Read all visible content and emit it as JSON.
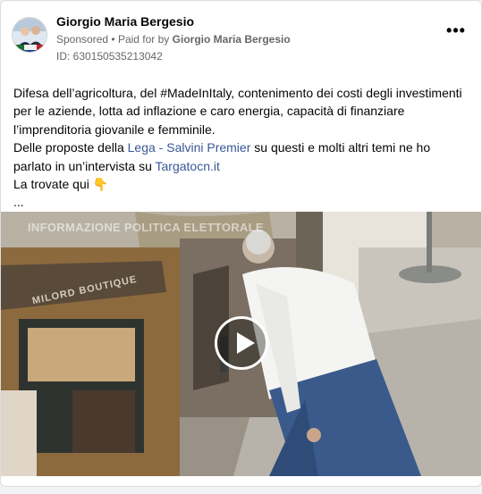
{
  "post": {
    "author": "Giorgio Maria Bergesio",
    "sponsored_label": "Sponsored",
    "paid_for_prefix": "Paid for by",
    "paid_for_name": "Giorgio Maria Bergesio",
    "separator": "•",
    "ad_id": "ID: 630150535213042",
    "more_icon": "more-options-icon",
    "more_glyph": "•••"
  },
  "body": {
    "line1": "Difesa dell’agricoltura, del #MadeInItaly, contenimento dei costi degli investimenti per le aziende, lotta ad inflazione e caro energia, capacità di finanziare l’imprenditoria giovanile e femminile.",
    "line2_prefix": "Delle proposte della ",
    "line2_link": "Lega - Salvini Premier",
    "line2_suffix": " su questi e molti altri temi ne ho parlato in un’intervista su ",
    "line2_link2": "Targatocn.it",
    "line3": "La trovate qui 👇",
    "ellipsis": "..."
  },
  "media": {
    "overlay_label": "INFORMAZIONE POLITICA ELETTORALE",
    "shop_sign": "MILORD BOUTIQUE",
    "play_icon": "play-icon",
    "colors": {
      "link": "#385898",
      "secondary_text": "#65676b"
    }
  }
}
